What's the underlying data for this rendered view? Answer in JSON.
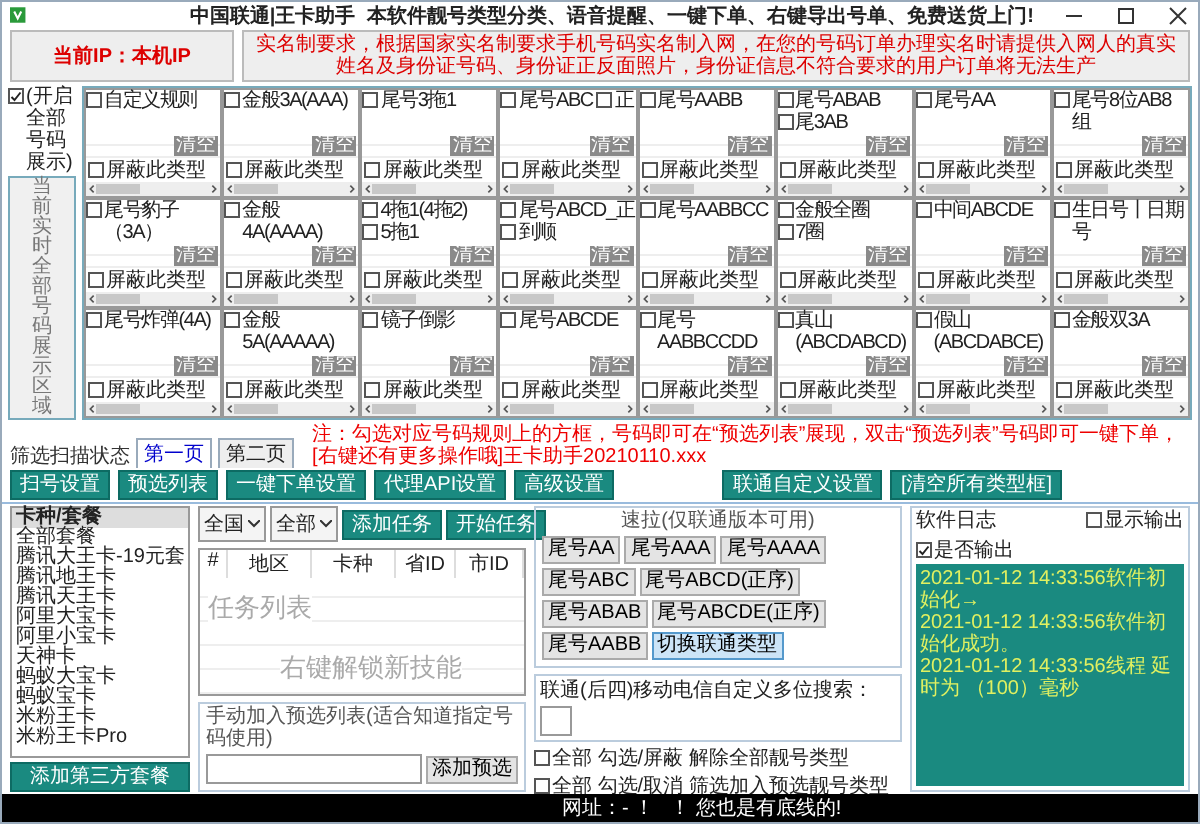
{
  "window": {
    "title": "中国联通|王卡助手",
    "slogan": "本软件靓号类型分类、语音提醒、一键下单、右键导出号单、免费送货上门!"
  },
  "ip_label": "当前IP：本机IP",
  "notice": "实名制要求，根据国家实名制要求手机号码实名制入网，在您的号码订单办理实名时请提供入网人的真实姓名及身份证号码、身份证正反面照片，身份证信息不符合要求的用户订单将无法生产",
  "show_all": {
    "label": "(开启全部号码展示)",
    "checked": true
  },
  "display_area": "当前实时全部号码展示区域",
  "scan_status": "筛选扫描状态",
  "rule_cells": [
    {
      "options": [
        {
          "label": "自定义规则",
          "checked": false
        }
      ],
      "block": {
        "label": "屏蔽此类型",
        "checked": false
      },
      "clear": {
        "label": "清空",
        "disabled": true
      }
    },
    {
      "options": [
        {
          "label": "金般3A(AAA)",
          "checked": false
        }
      ],
      "block": {
        "label": "屏蔽此类型",
        "checked": false
      },
      "clear": {
        "label": "清空",
        "disabled": true
      }
    },
    {
      "options": [
        {
          "label": "尾号3拖1",
          "checked": false
        }
      ],
      "block": {
        "label": "屏蔽此类型",
        "checked": false
      },
      "clear": {
        "label": "清空",
        "disabled": true
      }
    },
    {
      "options": [
        {
          "label": "尾号ABC",
          "checked": false
        },
        {
          "label": "正",
          "checked": false
        }
      ],
      "block": {
        "label": "屏蔽此类型",
        "checked": false
      },
      "clear": {
        "label": "清空",
        "disabled": true
      }
    },
    {
      "options": [
        {
          "label": "尾号AABB",
          "checked": false
        }
      ],
      "block": {
        "label": "屏蔽此类型",
        "checked": false
      },
      "clear": {
        "label": "清空",
        "disabled": true
      }
    },
    {
      "options": [
        {
          "label": "尾号ABAB",
          "checked": false
        },
        {
          "label": "尾3AB",
          "checked": false
        }
      ],
      "block": {
        "label": "屏蔽此类型",
        "checked": false
      },
      "clear": {
        "label": "清空",
        "disabled": true
      }
    },
    {
      "options": [
        {
          "label": "尾号AA",
          "checked": false
        }
      ],
      "block": {
        "label": "屏蔽此类型",
        "checked": false
      },
      "clear": {
        "label": "清空",
        "disabled": true
      }
    },
    {
      "options": [
        {
          "label": "尾号8位AB8组",
          "checked": false
        }
      ],
      "block": {
        "label": "屏蔽此类型",
        "checked": false
      },
      "clear": {
        "label": "清空",
        "disabled": true
      }
    },
    {
      "options": [
        {
          "label": "尾号豹子（3A）",
          "checked": false
        }
      ],
      "block": {
        "label": "屏蔽此类型",
        "checked": false
      },
      "clear": {
        "label": "清空",
        "disabled": true
      }
    },
    {
      "options": [
        {
          "label": "金般4A(AAAA)",
          "checked": false
        }
      ],
      "block": {
        "label": "屏蔽此类型",
        "checked": false
      },
      "clear": {
        "label": "清空",
        "disabled": true
      }
    },
    {
      "options": [
        {
          "label": "4拖1(4拖2)",
          "checked": false
        },
        {
          "label": "5拖1",
          "checked": false
        }
      ],
      "block": {
        "label": "屏蔽此类型",
        "checked": false
      },
      "clear": {
        "label": "清空",
        "disabled": true
      }
    },
    {
      "options": [
        {
          "label": "尾号ABCD_正",
          "checked": false
        },
        {
          "label": "到顺",
          "checked": false
        }
      ],
      "block": {
        "label": "屏蔽此类型",
        "checked": false
      },
      "clear": {
        "label": "清空",
        "disabled": true
      }
    },
    {
      "options": [
        {
          "label": "尾号AABBCC",
          "checked": false
        }
      ],
      "block": {
        "label": "屏蔽此类型",
        "checked": false
      },
      "clear": {
        "label": "清空",
        "disabled": true
      }
    },
    {
      "options": [
        {
          "label": "金般全圈",
          "checked": false
        },
        {
          "label": "7圈",
          "checked": false
        }
      ],
      "block": {
        "label": "屏蔽此类型",
        "checked": false
      },
      "clear": {
        "label": "清空",
        "disabled": true
      }
    },
    {
      "options": [
        {
          "label": "中间ABCDE",
          "checked": false
        }
      ],
      "block": {
        "label": "屏蔽此类型",
        "checked": false
      },
      "clear": {
        "label": "清空",
        "disabled": true
      }
    },
    {
      "options": [
        {
          "label": "生日号丨日期号",
          "checked": false
        }
      ],
      "block": {
        "label": "屏蔽此类型",
        "checked": false
      },
      "clear": {
        "label": "清空",
        "disabled": true
      }
    },
    {
      "options": [
        {
          "label": "尾号炸弹(4A)",
          "checked": false
        }
      ],
      "block": {
        "label": "屏蔽此类型",
        "checked": false
      },
      "clear": {
        "label": "清空",
        "disabled": true
      }
    },
    {
      "options": [
        {
          "label": "金般5A(AAAAA)",
          "checked": false
        }
      ],
      "block": {
        "label": "屏蔽此类型",
        "checked": false
      },
      "clear": {
        "label": "清空",
        "disabled": true
      }
    },
    {
      "options": [
        {
          "label": "镜子倒影",
          "checked": false
        }
      ],
      "block": {
        "label": "屏蔽此类型",
        "checked": false
      },
      "clear": {
        "label": "清空",
        "disabled": true
      }
    },
    {
      "options": [
        {
          "label": "尾号ABCDE",
          "checked": false
        }
      ],
      "block": {
        "label": "屏蔽此类型",
        "checked": false
      },
      "clear": {
        "label": "清空",
        "disabled": true
      }
    },
    {
      "options": [
        {
          "label": "尾号AABBCCDD",
          "checked": false
        }
      ],
      "block": {
        "label": "屏蔽此类型",
        "checked": false
      },
      "clear": {
        "label": "清空",
        "disabled": true
      }
    },
    {
      "options": [
        {
          "label": "真山(ABCDABCD)",
          "checked": false
        }
      ],
      "block": {
        "label": "屏蔽此类型",
        "checked": false
      },
      "clear": {
        "label": "清空",
        "disabled": true
      }
    },
    {
      "options": [
        {
          "label": "假山(ABCDABCE)",
          "checked": false
        }
      ],
      "block": {
        "label": "屏蔽此类型",
        "checked": false
      },
      "clear": {
        "label": "清空",
        "disabled": true
      }
    },
    {
      "options": [
        {
          "label": "金般双3A",
          "checked": false
        }
      ],
      "block": {
        "label": "屏蔽此类型",
        "checked": false
      },
      "clear": {
        "label": "清空",
        "disabled": true
      }
    }
  ],
  "tabs": [
    {
      "label": "第一页",
      "selected": true
    },
    {
      "label": "第二页",
      "selected": false
    }
  ],
  "hint": "注：勾选对应号码规则上的方框，号码即可在“预选列表”展现，双击“预选列表”号码即可一键下单，[右键还有更多操作哦]王卡助手20210110.xxx",
  "toolbar": [
    "扫号设置",
    "预选列表",
    "一键下单设置",
    "代理API设置",
    "高级设置"
  ],
  "toolbar_right": [
    "联通自定义设置",
    "[清空所有类型框]"
  ],
  "plans": {
    "header": "卡种/套餐",
    "items": [
      "全部套餐",
      "腾讯大王卡-19元套",
      "腾讯地王卡",
      "腾讯天王卡",
      "阿里大宝卡",
      "阿里小宝卡",
      "天神卡",
      "蚂蚁大宝卡",
      "蚂蚁宝卡",
      "米粉王卡",
      "米粉王卡Pro"
    ],
    "add_button": "添加第三方套餐"
  },
  "filters": [
    {
      "value": "全国"
    },
    {
      "value": "全部"
    }
  ],
  "task_buttons": [
    "添加任务",
    "开始任务"
  ],
  "task_table": {
    "columns": [
      "#",
      "地区",
      "卡种",
      "省ID",
      "市ID"
    ],
    "hints": [
      "任务列表",
      "右键解锁新技能"
    ]
  },
  "manual": {
    "title": "手动加入预选列表(适合知道指定号码使用)",
    "button": "添加预选"
  },
  "quick": {
    "title": "速拉(仅联通版本可用)",
    "buttons": [
      {
        "label": "尾号AA",
        "selected": false
      },
      {
        "label": "尾号AAA",
        "selected": false
      },
      {
        "label": "尾号AAAA",
        "selected": false
      },
      {
        "label": "尾号ABC",
        "selected": false
      },
      {
        "label": "尾号ABCD(正序)",
        "selected": false
      },
      {
        "label": "尾号ABAB",
        "selected": false
      },
      {
        "label": "尾号ABCDE(正序)",
        "selected": false
      },
      {
        "label": "尾号AABB",
        "selected": false
      },
      {
        "label": "切换联通类型",
        "selected": true
      }
    ]
  },
  "search_label": "联通(后四)移动电信自定义多位搜索：",
  "bulk_options": [
    {
      "label": "全部 勾选/屏蔽 解除全部靓号类型",
      "checked": false
    },
    {
      "label": "全部 勾选/取消 筛选加入预选靓号类型",
      "checked": false
    }
  ],
  "log": {
    "title": "软件日志",
    "options": [
      {
        "label": "显示输出",
        "checked": false
      },
      {
        "label": "是否输出",
        "checked": true
      }
    ],
    "lines": [
      "2021-01-12 14:33:56软件初始化→",
      "2021-01-12 14:33:56软件初始化成功。",
      "2021-01-12 14:33:56线程 延时为 （100）毫秒"
    ]
  },
  "status_bar": [
    "网址：- ！",
    "！ 您也是有底线的!"
  ]
}
